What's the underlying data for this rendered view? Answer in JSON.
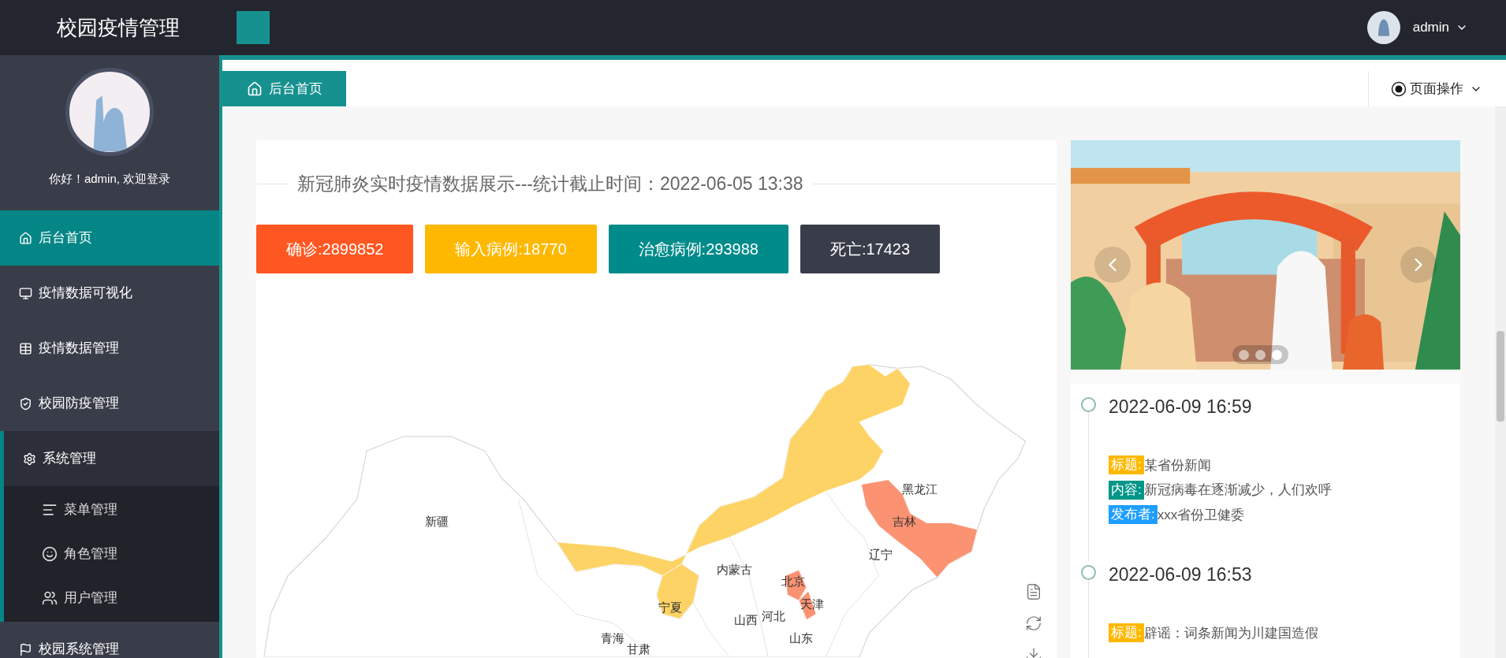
{
  "header": {
    "title": "校园疫情管理",
    "user": "admin"
  },
  "sidebar": {
    "greeting": "你好！admin, 欢迎登录",
    "items": [
      {
        "label": "后台首页",
        "selected": true,
        "expanded": false
      },
      {
        "label": "疫情数据可视化",
        "selected": false,
        "expanded": false
      },
      {
        "label": "疫情数据管理",
        "selected": false,
        "expanded": false
      },
      {
        "label": "校园防疫管理",
        "selected": false,
        "expanded": false
      },
      {
        "label": "系统管理",
        "selected": false,
        "expanded": true,
        "children": [
          {
            "label": "菜单管理",
            "selected": false
          },
          {
            "label": "角色管理",
            "selected": false
          },
          {
            "label": "用户管理",
            "selected": false
          }
        ]
      },
      {
        "label": "校园系统管理",
        "selected": false,
        "expanded": false
      }
    ]
  },
  "tabs": [
    {
      "label": "后台首页",
      "selected": true
    }
  ],
  "page_actions": "页面操作",
  "stats_panel": {
    "title": "新冠肺炎实时疫情数据展示---统计截止时间：2022-06-05 13:38",
    "stats": [
      {
        "text": "确诊:2899852",
        "color": "#ff5722"
      },
      {
        "text": "输入病例:18770",
        "color": "#ffb800"
      },
      {
        "text": "治愈病例:293988",
        "color": "#008b8b"
      },
      {
        "text": "死亡:17423",
        "color": "#393d49"
      }
    ]
  },
  "map": {
    "regions": [
      {
        "name": "新疆"
      },
      {
        "name": "黑龙江"
      },
      {
        "name": "吉林",
        "color": "#fb9272"
      },
      {
        "name": "辽宁"
      },
      {
        "name": "内蒙古",
        "color": "#fdd365"
      },
      {
        "name": "北京",
        "color": "#fb9272"
      },
      {
        "name": "天津",
        "color": "#fb9272"
      },
      {
        "name": "宁夏",
        "color": "#fdd365"
      },
      {
        "name": "山西"
      },
      {
        "name": "河北"
      },
      {
        "name": "山东"
      },
      {
        "name": "青海"
      },
      {
        "name": "甘肃"
      }
    ]
  },
  "carousel": {
    "indicators": [
      {
        "selected": false
      },
      {
        "selected": false
      },
      {
        "selected": true
      }
    ]
  },
  "timeline": [
    {
      "time": "2022-06-09 16:59",
      "fields": [
        {
          "label": "标题:",
          "value": "某省份新闻",
          "color": "#ffb800"
        },
        {
          "label": "内容:",
          "value": "新冠病毒在逐渐减少，人们欢呼",
          "color": "#009688"
        },
        {
          "label": "发布者:",
          "value": "xxx省份卫健委",
          "color": "#1e9fff"
        }
      ]
    },
    {
      "time": "2022-06-09 16:53",
      "fields": [
        {
          "label": "标题:",
          "value": "辟谣：词条新闻为川建国造假",
          "color": "#ffb800"
        }
      ]
    }
  ]
}
